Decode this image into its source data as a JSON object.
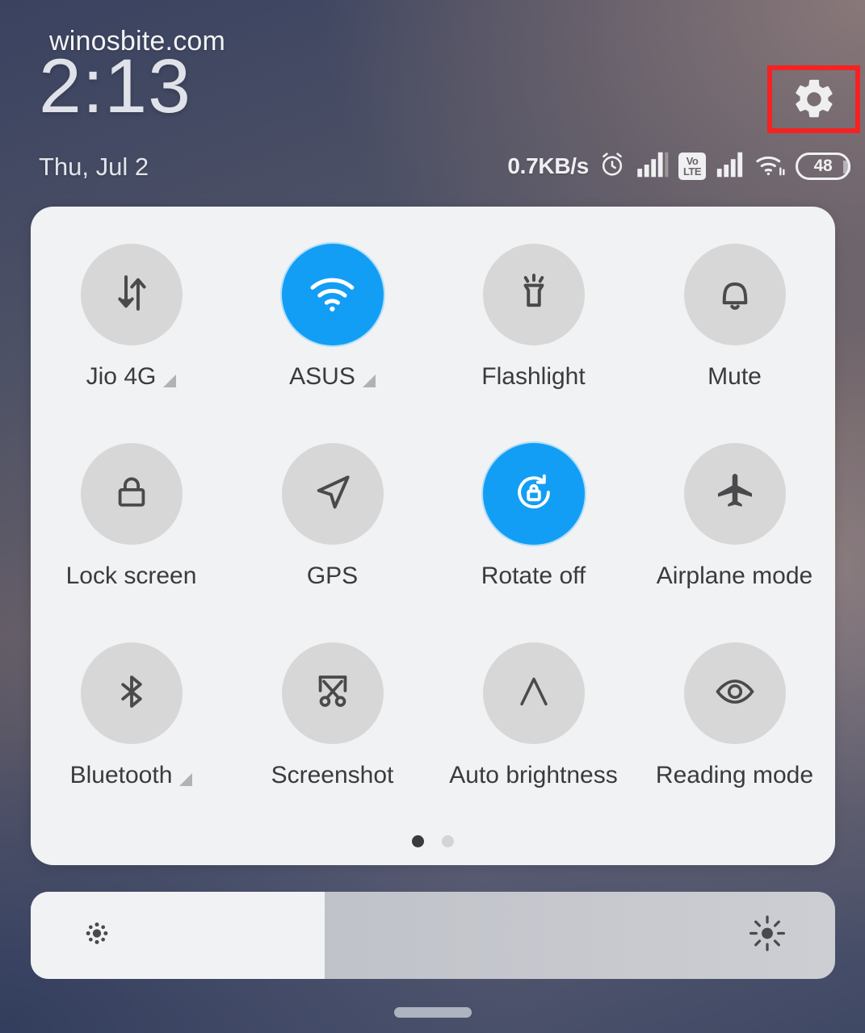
{
  "watermark": "winosbite.com",
  "lockscreen": {
    "time": "2:13",
    "date": "Thu, Jul 2"
  },
  "statusbar": {
    "network_speed": "0.7KB/s",
    "alarm_icon": "alarm-clock-icon",
    "signal_sim1_icon": "signal-bars-icon",
    "volte_line1": "Vo",
    "volte_line2": "LTE",
    "signal_sim2_icon": "signal-bars-icon",
    "wifi_icon": "wifi-icon",
    "battery_level": "48"
  },
  "header": {
    "settings_button": "gear-icon",
    "highlight_color": "#f52222"
  },
  "colors": {
    "active_tile": "#139ef5",
    "inactive_tile": "#d7d7d8",
    "panel": "#f1f2f4",
    "label": "#3b3b3d"
  },
  "quick_settings": {
    "tiles": [
      {
        "label": "Jio 4G",
        "icon": "mobile-data-icon",
        "active": false,
        "expandable": true
      },
      {
        "label": "ASUS",
        "icon": "wifi-icon",
        "active": true,
        "expandable": true
      },
      {
        "label": "Flashlight",
        "icon": "flashlight-icon",
        "active": false,
        "expandable": false
      },
      {
        "label": "Mute",
        "icon": "bell-icon",
        "active": false,
        "expandable": false
      },
      {
        "label": "Lock screen",
        "icon": "padlock-icon",
        "active": false,
        "expandable": false
      },
      {
        "label": "GPS",
        "icon": "location-arrow-icon",
        "active": false,
        "expandable": false
      },
      {
        "label": "Rotate off",
        "icon": "rotation-lock-icon",
        "active": true,
        "expandable": false
      },
      {
        "label": "Airplane mode",
        "icon": "airplane-icon",
        "active": false,
        "expandable": false
      },
      {
        "label": "Bluetooth",
        "icon": "bluetooth-icon",
        "active": false,
        "expandable": true
      },
      {
        "label": "Screenshot",
        "icon": "scissors-icon",
        "active": false,
        "expandable": false
      },
      {
        "label": "Auto brightness",
        "icon": "letter-a-icon",
        "active": false,
        "expandable": false
      },
      {
        "label": "Reading mode",
        "icon": "eye-icon",
        "active": false,
        "expandable": false
      }
    ],
    "pages": 2,
    "current_page": 1
  },
  "brightness_slider": {
    "value_percent": 36.5,
    "low_icon": "brightness-low-icon",
    "high_icon": "brightness-high-icon"
  },
  "navigation": {
    "home_indicator": "home-indicator-pill"
  }
}
